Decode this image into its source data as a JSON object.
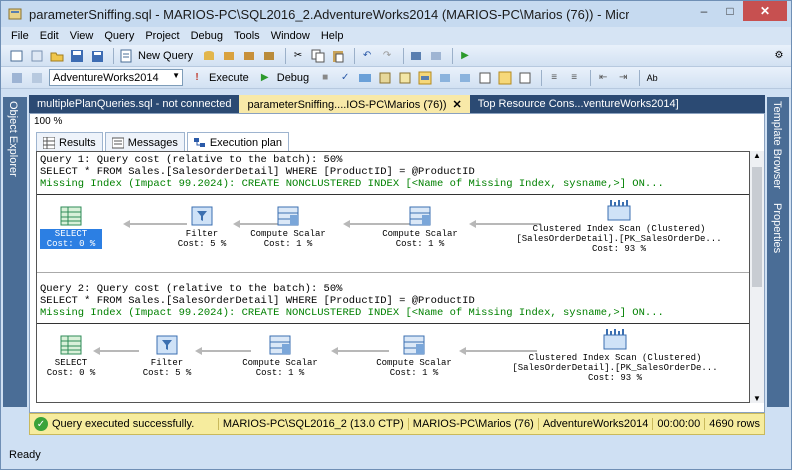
{
  "window": {
    "title": "parameterSniffing.sql - MARIOS-PC\\SQL2016_2.AdventureWorks2014 (MARIOS-PC\\Marios (76)) - Microsoft SQL Serv...",
    "min": "–",
    "max": "□",
    "close": "✕"
  },
  "menu": [
    "File",
    "Edit",
    "View",
    "Query",
    "Project",
    "Debug",
    "Tools",
    "Window",
    "Help"
  ],
  "toolbar1": {
    "new_query": "New Query"
  },
  "toolbar2": {
    "database": "AdventureWorks2014",
    "execute": "Execute",
    "debug": "Debug"
  },
  "side": {
    "left": "Object Explorer",
    "right1": "Template Browser",
    "right2": "Properties"
  },
  "doc_tabs": [
    {
      "label": "multiplePlanQueries.sql - not connected"
    },
    {
      "label": "parameterSniffing....IOS-PC\\Marios (76))",
      "close": "✕"
    },
    {
      "label": "Top Resource Cons...ventureWorks2014]"
    }
  ],
  "zoom": "100 %",
  "result_tabs": [
    "Results",
    "Messages",
    "Execution plan"
  ],
  "queries": [
    {
      "line1": "Query 1: Query cost (relative to the batch): 50%",
      "line2": "SELECT * FROM Sales.[SalesOrderDetail] WHERE [ProductID] = @ProductID",
      "line3": "Missing Index (Impact 99.2024): CREATE NONCLUSTERED INDEX [<Name of Missing Index, sysname,>] ON...",
      "ops": [
        {
          "name": "SELECT",
          "cost": "Cost: 0 %"
        },
        {
          "name": "Filter",
          "cost": "Cost: 5 %"
        },
        {
          "name": "Compute Scalar",
          "cost": "Cost: 1 %"
        },
        {
          "name": "Compute Scalar",
          "cost": "Cost: 1 %"
        },
        {
          "name": "Clustered Index Scan (Clustered)",
          "sub": "[SalesOrderDetail].[PK_SalesOrderDe...",
          "cost": "Cost: 93 %"
        }
      ]
    },
    {
      "line1": "Query 2: Query cost (relative to the batch): 50%",
      "line2": "SELECT * FROM Sales.[SalesOrderDetail] WHERE [ProductID] = @ProductID",
      "line3": "Missing Index (Impact 99.2024): CREATE NONCLUSTERED INDEX [<Name of Missing Index, sysname,>] ON...",
      "ops": [
        {
          "name": "SELECT",
          "cost": "Cost: 0 %"
        },
        {
          "name": "Filter",
          "cost": "Cost: 5 %"
        },
        {
          "name": "Compute Scalar",
          "cost": "Cost: 1 %"
        },
        {
          "name": "Compute Scalar",
          "cost": "Cost: 1 %"
        },
        {
          "name": "Clustered Index Scan (Clustered)",
          "sub": "[SalesOrderDetail].[PK_SalesOrderDe...",
          "cost": "Cost: 93 %"
        }
      ]
    }
  ],
  "status": {
    "message": "Query executed successfully.",
    "server": "MARIOS-PC\\SQL2016_2 (13.0 CTP)",
    "user": "MARIOS-PC\\Marios (76)",
    "db": "AdventureWorks2014",
    "time": "00:00:00",
    "rows": "4690 rows"
  },
  "ready": "Ready"
}
